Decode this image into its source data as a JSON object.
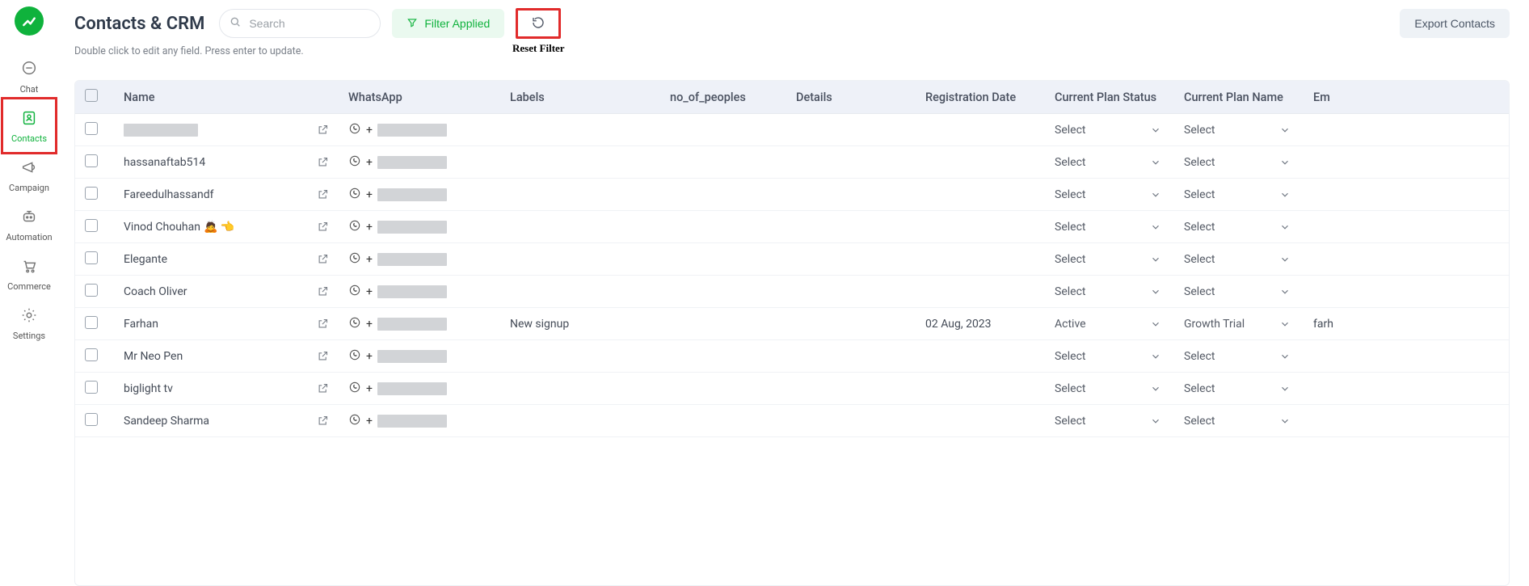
{
  "sidebar": {
    "items": [
      {
        "label": "Chat",
        "icon": "chat-icon"
      },
      {
        "label": "Contacts",
        "icon": "contacts-icon"
      },
      {
        "label": "Campaign",
        "icon": "campaign-icon"
      },
      {
        "label": "Automation",
        "icon": "automation-icon"
      },
      {
        "label": "Commerce",
        "icon": "commerce-icon"
      },
      {
        "label": "Settings",
        "icon": "settings-icon"
      }
    ]
  },
  "header": {
    "title": "Contacts & CRM",
    "search_placeholder": "Search",
    "filter_label": "Filter Applied",
    "reset_caption": "Reset Filter",
    "export_label": "Export Contacts",
    "subtext": "Double click to edit any field. Press enter to update."
  },
  "table": {
    "columns": {
      "name": "Name",
      "whatsapp": "WhatsApp",
      "labels": "Labels",
      "no_of_peoples": "no_of_peoples",
      "details": "Details",
      "registration_date": "Registration Date",
      "current_plan_status": "Current Plan Status",
      "current_plan_name": "Current Plan Name",
      "email_partial": "Em"
    },
    "select_placeholder": "Select",
    "rows": [
      {
        "name": "",
        "name_redact": true,
        "labels": "",
        "reg": "",
        "status": "Select",
        "plan": "Select",
        "email": ""
      },
      {
        "name": "hassanaftab514",
        "labels": "",
        "reg": "",
        "status": "Select",
        "plan": "Select",
        "email": ""
      },
      {
        "name": "Fareedulhassandf",
        "labels": "",
        "reg": "",
        "status": "Select",
        "plan": "Select",
        "email": ""
      },
      {
        "name": "Vinod Chouhan",
        "emoji": "🙇 👈",
        "labels": "",
        "reg": "",
        "status": "Select",
        "plan": "Select",
        "email": ""
      },
      {
        "name": "Elegante",
        "labels": "",
        "reg": "",
        "status": "Select",
        "plan": "Select",
        "email": ""
      },
      {
        "name": "Coach Oliver",
        "labels": "",
        "reg": "",
        "status": "Select",
        "plan": "Select",
        "email": ""
      },
      {
        "name": "Farhan",
        "labels": "New signup",
        "reg": "02 Aug, 2023",
        "status": "Active",
        "plan": "Growth Trial",
        "email": "farh"
      },
      {
        "name": "Mr Neo Pen",
        "labels": "",
        "reg": "",
        "status": "Select",
        "plan": "Select",
        "email": ""
      },
      {
        "name": "biglight tv",
        "labels": "",
        "reg": "",
        "status": "Select",
        "plan": "Select",
        "email": ""
      },
      {
        "name": "Sandeep Sharma",
        "labels": "",
        "reg": "",
        "status": "Select",
        "plan": "Select",
        "email": ""
      }
    ]
  }
}
